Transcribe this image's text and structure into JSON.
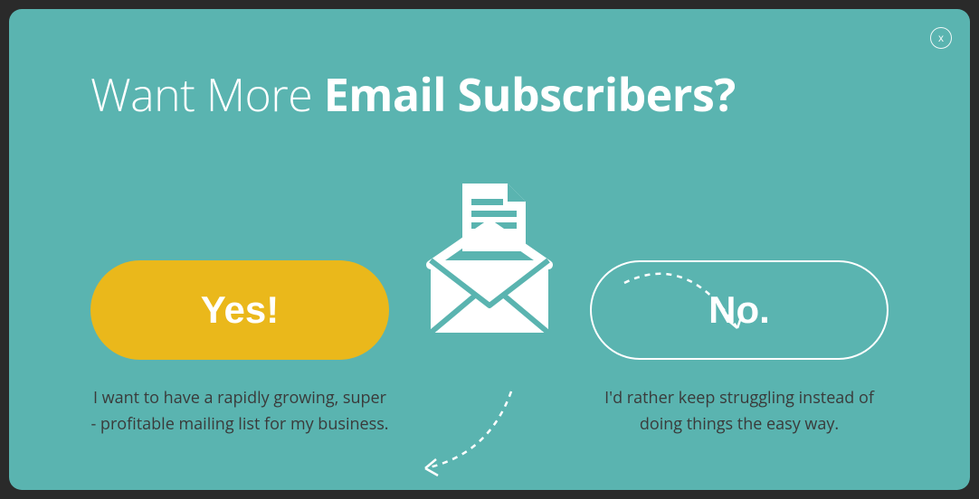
{
  "heading": {
    "light": "Want More ",
    "bold": "Email Subscribers?"
  },
  "close_label": "x",
  "options": {
    "yes": {
      "button": "Yes!",
      "caption": "I want to have a rapidly growing, super - profitable mailing list for my business."
    },
    "no": {
      "button": "No.",
      "caption": "I'd rather keep struggling instead of doing things the easy way."
    }
  },
  "colors": {
    "modal_bg": "#5ab4b0",
    "yes_btn": "#eab81b",
    "text_white": "#ffffff",
    "caption": "#3a3a3a"
  }
}
